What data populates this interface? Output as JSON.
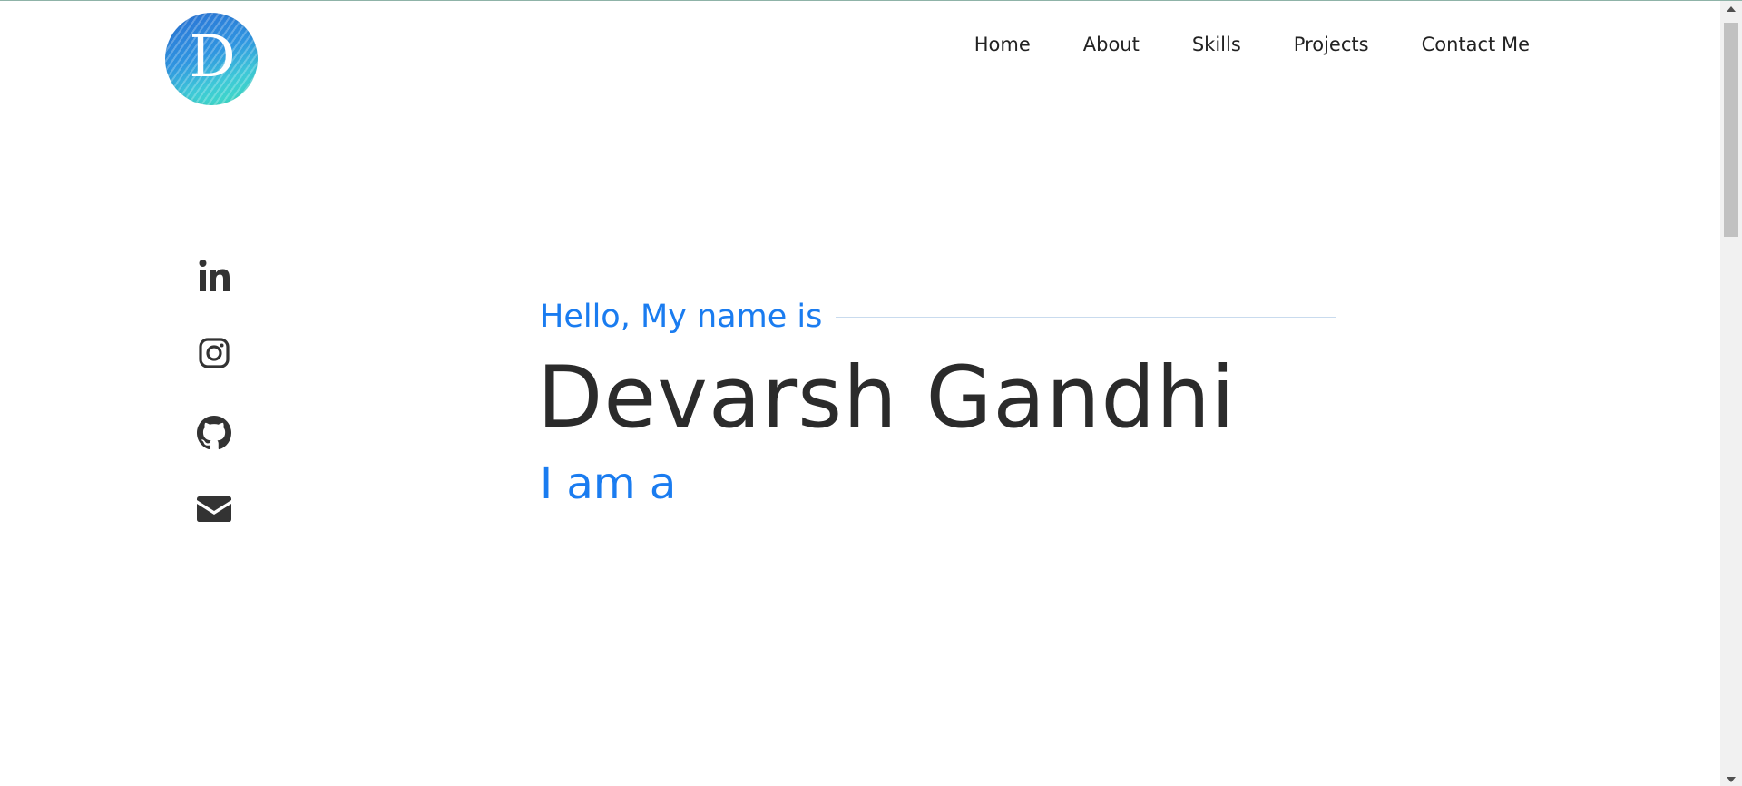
{
  "header": {
    "logo_letter": "D",
    "nav": [
      {
        "label": "Home"
      },
      {
        "label": "About"
      },
      {
        "label": "Skills"
      },
      {
        "label": "Projects"
      },
      {
        "label": "Contact Me"
      }
    ]
  },
  "social": [
    {
      "icon": "linkedin-icon"
    },
    {
      "icon": "instagram-icon"
    },
    {
      "icon": "github-icon"
    },
    {
      "icon": "email-icon"
    }
  ],
  "hero": {
    "greeting": "Hello, My name is",
    "name": "Devarsh Gandhi",
    "role_prefix": "I am a"
  },
  "colors": {
    "accent": "#1a7cf0",
    "text_dark": "#2b2b2b",
    "icon": "#333333"
  }
}
